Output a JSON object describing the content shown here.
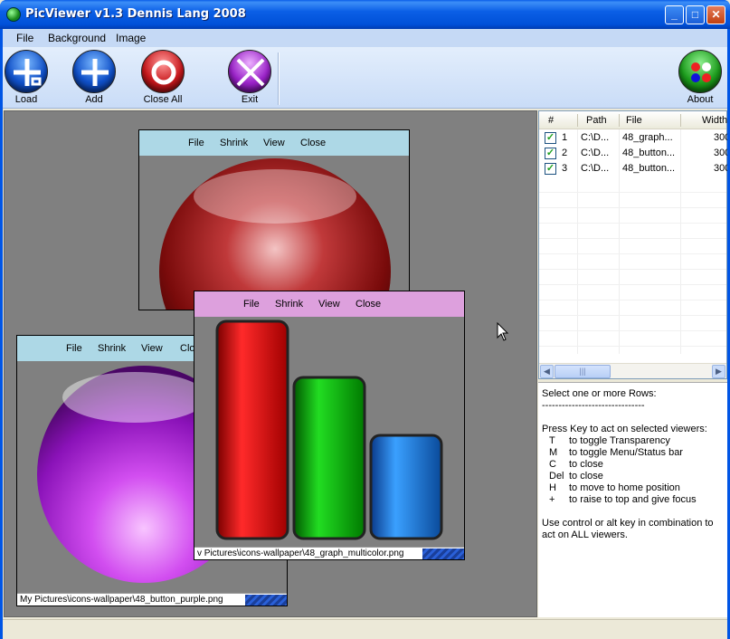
{
  "window": {
    "title": "PicViewer v1.3 Dennis Lang 2008",
    "minimize": "_",
    "maximize": "□",
    "close": "✕"
  },
  "menubar": {
    "file": "File",
    "background": "Background",
    "image": "Image"
  },
  "toolbar": {
    "load": "Load",
    "add": "Add",
    "close_all": "Close All",
    "exit": "Exit",
    "about": "About"
  },
  "viewers": {
    "red": {
      "menu": [
        "File",
        "Shrink",
        "View",
        "Close"
      ]
    },
    "purple": {
      "menu": [
        "File",
        "Shrink",
        "View",
        "Clo"
      ],
      "status": "My Pictures\\icons-wallpaper\\48_button_purple.png"
    },
    "graph": {
      "menu": [
        "File",
        "Shrink",
        "View",
        "Close"
      ],
      "status": "v Pictures\\icons-wallpaper\\48_graph_multicolor.png"
    }
  },
  "list": {
    "columns": [
      "#",
      "Path",
      "File",
      "Width"
    ],
    "rows": [
      {
        "num": "1",
        "path": "C:\\D...",
        "file": "48_graph...",
        "width": "300"
      },
      {
        "num": "2",
        "path": "C:\\D...",
        "file": "48_button...",
        "width": "300"
      },
      {
        "num": "3",
        "path": "C:\\D...",
        "file": "48_button...",
        "width": "300"
      }
    ],
    "thumb_glyph": "|||"
  },
  "help": {
    "line1": "Select one or more Rows:",
    "line2": "-------------------------------",
    "line3": "Press Key to act on selected viewers:",
    "keys": [
      {
        "key": "T",
        "desc": "to toggle Transparency"
      },
      {
        "key": "M",
        "desc": "to toggle Menu/Status bar"
      },
      {
        "key": "C",
        "desc": "to close"
      },
      {
        "key": "Del",
        "desc": "to close"
      },
      {
        "key": "H",
        "desc": "to move to home position"
      },
      {
        "key": "+",
        "desc": "to raise to top and give focus"
      }
    ],
    "line4": "Use control or alt key in combination to",
    "line5": "act on ALL viewers."
  },
  "colors": {
    "titlebar": "#0b5fe6",
    "menubar": "#c5d9f5",
    "red_viewer_menu": "#add8e6",
    "graph_viewer_menu": "#dda0dd",
    "workspace": "#808080"
  }
}
